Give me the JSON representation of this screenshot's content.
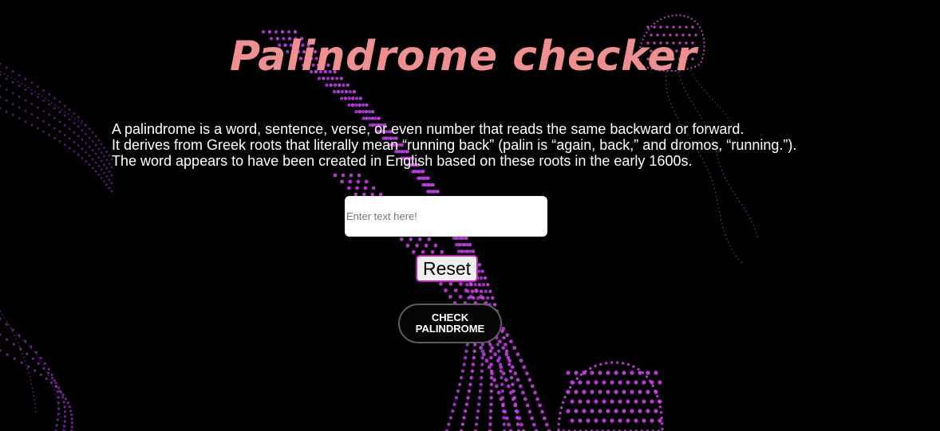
{
  "page": {
    "title": "Palindrome checker",
    "description": [
      "A palindrome is a word, sentence, verse, or even number that reads the same backward or forward.",
      "It derives from Greek roots that literally mean “running back” (palin is “again, back,” and dromos, “running.”).",
      "The word appears to have been created in English based on these roots in the early 1600s."
    ]
  },
  "form": {
    "input_value": "",
    "input_placeholder": "Enter text here!",
    "reset_label": "Reset",
    "check_label": "CHECK PALINDROME"
  },
  "colors": {
    "background": "#000000",
    "title": "#ef8f8f",
    "jellyfish": "#e040fb",
    "reset_border": "#c21fb5"
  },
  "icons": [
    "jellyfish-background"
  ]
}
